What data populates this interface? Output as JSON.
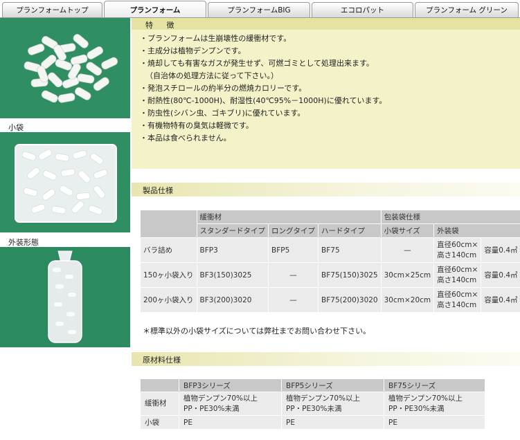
{
  "tabs": [
    {
      "label": "プランフォームトップ",
      "active": false
    },
    {
      "label": "プランフォーム",
      "active": true
    },
    {
      "label": "プランフォームBIG",
      "active": false
    },
    {
      "label": "エコロパット",
      "active": false
    },
    {
      "label": "プランフォーム グリーン",
      "active": false
    }
  ],
  "captions": {
    "small_bag": "小袋",
    "outer_pack": "外装形態"
  },
  "features": {
    "heading": "特 徴",
    "items": [
      "・プランフォームは生崩壊性の緩衝材です。",
      "・主成分は植物デンプンです。",
      "・焼却しても有害なガスが発生せず、可燃ゴミとして処理出来ます。",
      "（自治体の処理方法に従って下さい。）",
      "・発泡スチロールの約半分の燃焼カロリーです。",
      "・耐熱性(80℃-1000H)、耐湿性(40℃95%－1000H)に優れています。",
      "・防虫性(シバン虫、ゴキブリ)に優れています。",
      "・有機物特有の臭気は軽微です。",
      "・本品は食べられません。"
    ]
  },
  "spec": {
    "section_title": "製品仕様",
    "group_cushion": "緩衝材",
    "group_bag": "包装袋仕様",
    "col_standard": "スタンダードタイプ",
    "col_long": "ロングタイプ",
    "col_hard": "ハードタイプ",
    "col_small_bag": "小袋サイズ",
    "col_outer_bag": "外装袋",
    "rows": [
      {
        "label": "バラ詰め",
        "standard": "BFP3",
        "long": "BFP5",
        "hard": "BF75",
        "small_bag": "—",
        "outer1": "直径60cm×",
        "outer2": "高さ140cm",
        "capacity": "容量0.4㎥"
      },
      {
        "label": "150ヶ小袋入り",
        "standard": "BF3(150)3025",
        "long": "—",
        "hard": "BF75(150)3025",
        "small_bag": "30cm×25cm",
        "outer1": "直径60cm×",
        "outer2": "高さ140cm",
        "capacity": "容量0.4㎥"
      },
      {
        "label": "200ヶ小袋入り",
        "standard": "BF3(200)3020",
        "long": "—",
        "hard": "BF75(200)3020",
        "small_bag": "30cm×20cm",
        "outer1": "直径60cm×",
        "outer2": "高さ140cm",
        "capacity": "容量0.4㎥"
      }
    ],
    "note": "＊標準以外の小袋サイズについては弊社までお問い合わせ下さい。"
  },
  "material": {
    "section_title": "原材料仕様",
    "headers": [
      "BFP3シリーズ",
      "BFP5シリーズ",
      "BF75シリーズ"
    ],
    "rows": [
      {
        "label": "緩衝材",
        "values": [
          [
            "植物デンプン70%以上",
            "PP・PE30%未満"
          ],
          [
            "植物デンプン70%以上",
            "PP・PE30%未満"
          ],
          [
            "植物デンプン70%以上",
            "PP・PE30%未満"
          ]
        ]
      },
      {
        "label": "小袋",
        "values": [
          [
            "PE"
          ],
          [
            "PE"
          ],
          [
            "PE"
          ]
        ]
      }
    ]
  },
  "colors": {
    "panel": "#f3f2c8",
    "panel_head": "#e5e3a2",
    "photo_bg": "#2f8e62",
    "table_head": "#c8c8c8",
    "table_cell": "#ebebeb"
  }
}
